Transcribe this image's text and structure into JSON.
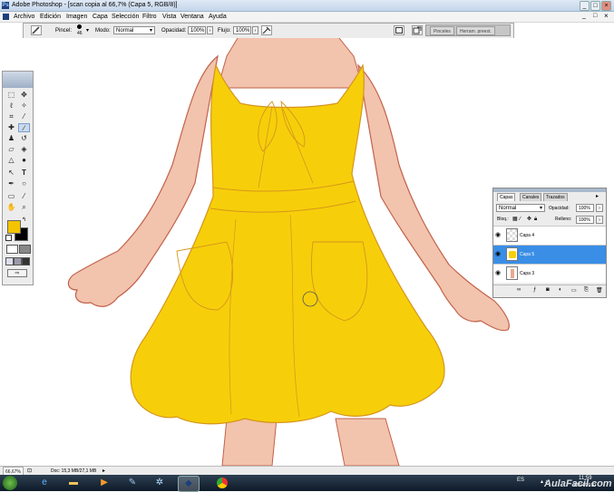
{
  "window": {
    "title": "Adobe Photoshop - [scan copia al 66,7% (Capa 5, RGB/8)]",
    "minimize": "_",
    "maximize": "□",
    "close": "×"
  },
  "menu": [
    "Archivo",
    "Edición",
    "Imagen",
    "Capa",
    "Selección",
    "Filtro",
    "Vista",
    "Ventana",
    "Ayuda"
  ],
  "options_bar": {
    "brush_label": "Pincel:",
    "brush_size": "46",
    "mode_label": "Modo:",
    "mode_value": "Normal",
    "opacity_label": "Opacidad:",
    "opacity_value": "100%",
    "flow_label": "Flujo:",
    "flow_value": "100%",
    "palette_tabs": [
      "Pinceles",
      "Herram. preest."
    ]
  },
  "colors": {
    "foreground": "#f5c400",
    "background": "#000000",
    "dress": "#f6cf0a",
    "dress_line": "#d6951c",
    "skin": "#f2c3ad",
    "skin_line": "#c2624b",
    "selected_layer": "#3a8ee6"
  },
  "layers_panel": {
    "tabs": [
      "Capas",
      "Canales",
      "Trazados"
    ],
    "blend_mode": "Normal",
    "opacity_label": "Opacidad:",
    "opacity_value": "100%",
    "lock_label": "Bloq.:",
    "fill_label": "Relleno:",
    "fill_value": "100%",
    "layers": [
      {
        "name": "Capa 4",
        "selected": false
      },
      {
        "name": "Capa 5",
        "selected": true
      },
      {
        "name": "Capa 3",
        "selected": false
      }
    ]
  },
  "status_bar": {
    "zoom": "66,67%",
    "doc_info": "Doc: 15,3 MB/27,1 MB"
  },
  "taskbar": {
    "lang": "ES",
    "time": "11:59",
    "date": "27/04/2010",
    "watermark": "AulaFacil.com"
  }
}
